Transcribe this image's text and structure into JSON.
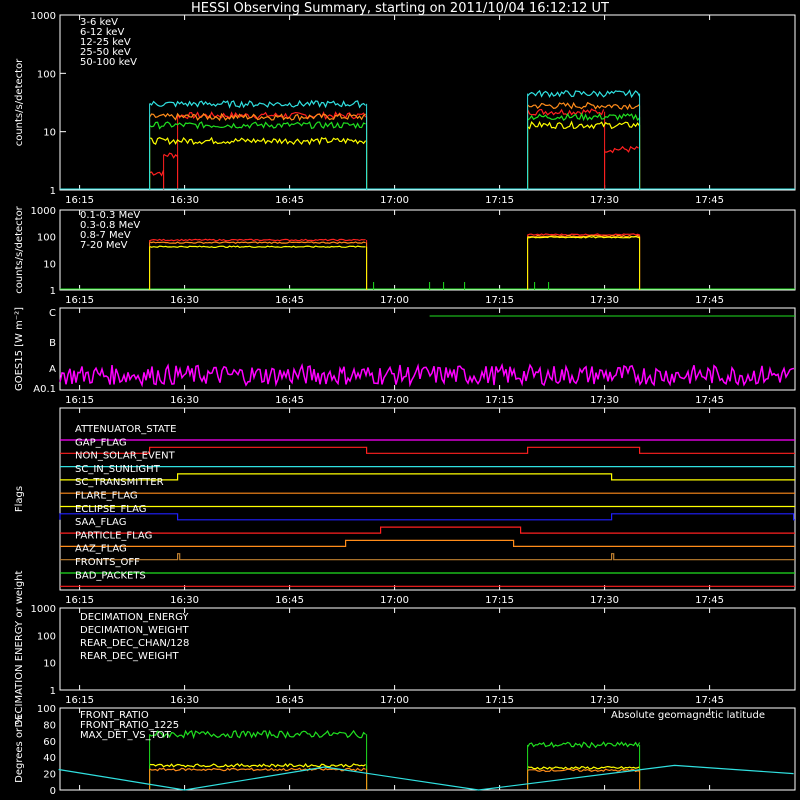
{
  "title": "HESSI Observing Summary, starting on 2011/10/04 16:12:12 UT",
  "time_ticks": [
    "16:15",
    "16:30",
    "16:45",
    "17:00",
    "17:15",
    "17:30",
    "17:45"
  ],
  "chart_data": [
    {
      "type": "line",
      "name": "panel-1-hxr-rates",
      "ylabel": "counts/s/detector",
      "yscale": "log",
      "yticks": [
        "1",
        "10",
        "100",
        "1000"
      ],
      "ylim": [
        1,
        1000
      ],
      "series": [
        {
          "name": "3-6 keV",
          "color": "#ff2020",
          "segments": [
            {
              "from": "16:25",
              "to": "16:27",
              "value": 2
            },
            {
              "from": "16:27",
              "to": "16:29",
              "value": 4
            },
            {
              "from": "16:29",
              "to": "16:56",
              "value": 19
            },
            {
              "from": "17:19",
              "to": "17:30",
              "value": 22
            },
            {
              "from": "17:30",
              "to": "17:35",
              "value": 5
            }
          ]
        },
        {
          "name": "6-12 keV",
          "color": "#ff8c1a",
          "segments": [
            {
              "from": "16:25",
              "to": "16:56",
              "value": 18
            },
            {
              "from": "17:19",
              "to": "17:35",
              "value": 28
            }
          ]
        },
        {
          "name": "12-25 keV",
          "color": "#ffff00",
          "segments": [
            {
              "from": "16:25",
              "to": "16:56",
              "value": 7
            },
            {
              "from": "17:19",
              "to": "17:35",
              "value": 13
            }
          ]
        },
        {
          "name": "25-50 keV",
          "color": "#20e020",
          "segments": [
            {
              "from": "16:25",
              "to": "16:56",
              "value": 13
            },
            {
              "from": "17:19",
              "to": "17:35",
              "value": 18
            }
          ]
        },
        {
          "name": "50-100 keV",
          "color": "#30e0e0",
          "segments": [
            {
              "from": "16:25",
              "to": "16:56",
              "value": 30
            },
            {
              "from": "17:19",
              "to": "17:35",
              "value": 45
            }
          ]
        }
      ]
    },
    {
      "type": "line",
      "name": "panel-2-gamma-rates",
      "ylabel": "counts/s/detector",
      "yscale": "log",
      "yticks": [
        "1",
        "10",
        "100",
        "1000"
      ],
      "ylim": [
        1,
        1000
      ],
      "series": [
        {
          "name": "0.1-0.3 MeV",
          "color": "#ff2020",
          "segments": [
            {
              "from": "16:25",
              "to": "16:56",
              "value": 75
            },
            {
              "from": "17:19",
              "to": "17:35",
              "value": 120
            }
          ]
        },
        {
          "name": "0.3-0.8 MeV",
          "color": "#ff8c1a",
          "segments": [
            {
              "from": "16:25",
              "to": "16:56",
              "value": 60
            },
            {
              "from": "17:19",
              "to": "17:35",
              "value": 105
            }
          ]
        },
        {
          "name": "0.8-7 MeV",
          "color": "#ffff00",
          "segments": [
            {
              "from": "16:25",
              "to": "16:56",
              "value": 42
            },
            {
              "from": "17:19",
              "to": "17:35",
              "value": 95
            }
          ]
        },
        {
          "name": "7-20 MeV",
          "color": "#20e020",
          "segments": []
        }
      ]
    },
    {
      "type": "line",
      "name": "panel-3-goes",
      "ylabel": "GOES15 [W m⁻²]",
      "yticks": [
        "A0.1",
        "A",
        "B",
        "C"
      ],
      "series": [
        {
          "name": "GOES low",
          "color": "#ff00ff",
          "level": "A"
        },
        {
          "name": "GOES high",
          "color": "#20e020",
          "level": "C"
        }
      ]
    },
    {
      "type": "line",
      "name": "panel-4-flags",
      "ylabel": "Flags",
      "flags": [
        {
          "name": "ATTENUATOR_STATE",
          "color": "#ff00ff",
          "on": []
        },
        {
          "name": "GAP_FLAG",
          "color": "#ff2020",
          "on": [
            [
              "16:25",
              "16:56"
            ],
            [
              "17:19",
              "17:35"
            ]
          ]
        },
        {
          "name": "NON_SOLAR_EVENT",
          "color": "#30e0e0",
          "on": []
        },
        {
          "name": "SC_IN_SUNLIGHT",
          "color": "#ffff00",
          "on": [
            [
              "16:29",
              "17:31"
            ]
          ]
        },
        {
          "name": "SC_TRANSMITTER",
          "color": "#ff8c1a",
          "on": []
        },
        {
          "name": "FLARE_FLAG",
          "color": "#ffff00",
          "on": []
        },
        {
          "name": "ECLIPSE_FLAG",
          "color": "#2020ff",
          "on": [
            [
              "16:12",
              "16:29"
            ],
            [
              "17:31",
              "17:57"
            ]
          ]
        },
        {
          "name": "SAA_FLAG",
          "color": "#ff2020",
          "on": [
            [
              "16:58",
              "17:18"
            ]
          ]
        },
        {
          "name": "PARTICLE_FLAG",
          "color": "#ff8c1a",
          "on": [
            [
              "16:53",
              "17:17"
            ]
          ]
        },
        {
          "name": "AAZ_FLAG",
          "color": "#c08030",
          "on": [
            [
              "16:29",
              "16:29.3"
            ],
            [
              "17:31",
              "17:31.3"
            ]
          ]
        },
        {
          "name": "FRONTS_OFF",
          "color": "#20e020",
          "on": []
        },
        {
          "name": "BAD_PACKETS",
          "color": "#ff2020",
          "on": []
        }
      ]
    },
    {
      "type": "line",
      "name": "panel-5-decimation",
      "ylabel": "DECIMATION ENERGY or weight",
      "yscale": "log",
      "yticks": [
        "1",
        "10",
        "100",
        "1000"
      ],
      "series": [
        {
          "name": "DECIMATION_ENERGY",
          "color": "#20e020"
        },
        {
          "name": "DECIMATION_WEIGHT",
          "color": "#ff8c1a"
        },
        {
          "name": "REAR_DEC_CHAN/128",
          "color": "#30e0e0"
        },
        {
          "name": "REAR_DEC_WEIGHT",
          "color": "#c08030"
        }
      ]
    },
    {
      "type": "line",
      "name": "panel-6-ratios",
      "ylabel": "Degrees or %",
      "yticks": [
        "0",
        "20",
        "40",
        "60",
        "80",
        "100"
      ],
      "ylim": [
        0,
        100
      ],
      "annotation": "Absolute geomagnetic latitude",
      "series": [
        {
          "name": "FRONT_RATIO",
          "color": "#ffff00",
          "segments": [
            {
              "from": "16:25",
              "to": "16:56",
              "value": 30
            },
            {
              "from": "17:19",
              "to": "17:35",
              "value": 27
            }
          ]
        },
        {
          "name": "FRONT_RATIO_1225",
          "color": "#20e020",
          "segments": [
            {
              "from": "16:25",
              "to": "16:56",
              "value": 68
            },
            {
              "from": "17:19",
              "to": "17:35",
              "value": 55
            }
          ]
        },
        {
          "name": "MAX_DET_VS_TOT",
          "color": "#ff8c1a",
          "segments": [
            {
              "from": "16:25",
              "to": "16:56",
              "value": 25
            },
            {
              "from": "17:19",
              "to": "17:35",
              "value": 24
            }
          ]
        },
        {
          "name": "Absolute geomagnetic latitude",
          "color": "#30e0e0",
          "points": [
            [
              "16:12",
              25
            ],
            [
              "16:30",
              0
            ],
            [
              "16:50",
              28
            ],
            [
              "17:12",
              0
            ],
            [
              "17:40",
              30
            ],
            [
              "17:57",
              20
            ]
          ]
        }
      ]
    }
  ]
}
